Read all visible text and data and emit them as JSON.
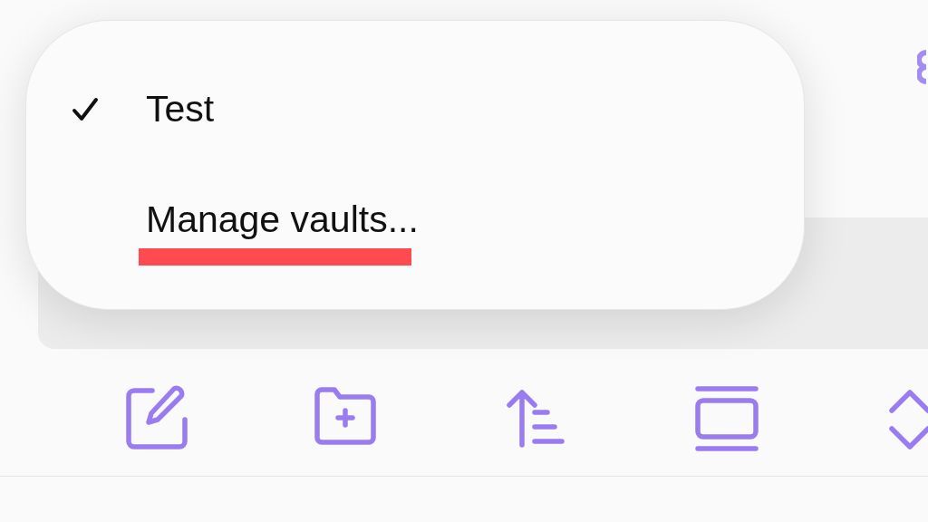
{
  "menu": {
    "items": [
      {
        "label": "Test",
        "selected": true,
        "underlined": false
      },
      {
        "label": "Manage vaults...",
        "selected": false,
        "underlined": true
      }
    ]
  },
  "toolbar": {
    "buttons": [
      {
        "kind": "new-note"
      },
      {
        "kind": "new-folder"
      },
      {
        "kind": "sort"
      },
      {
        "kind": "layout"
      },
      {
        "kind": "expand"
      }
    ]
  }
}
